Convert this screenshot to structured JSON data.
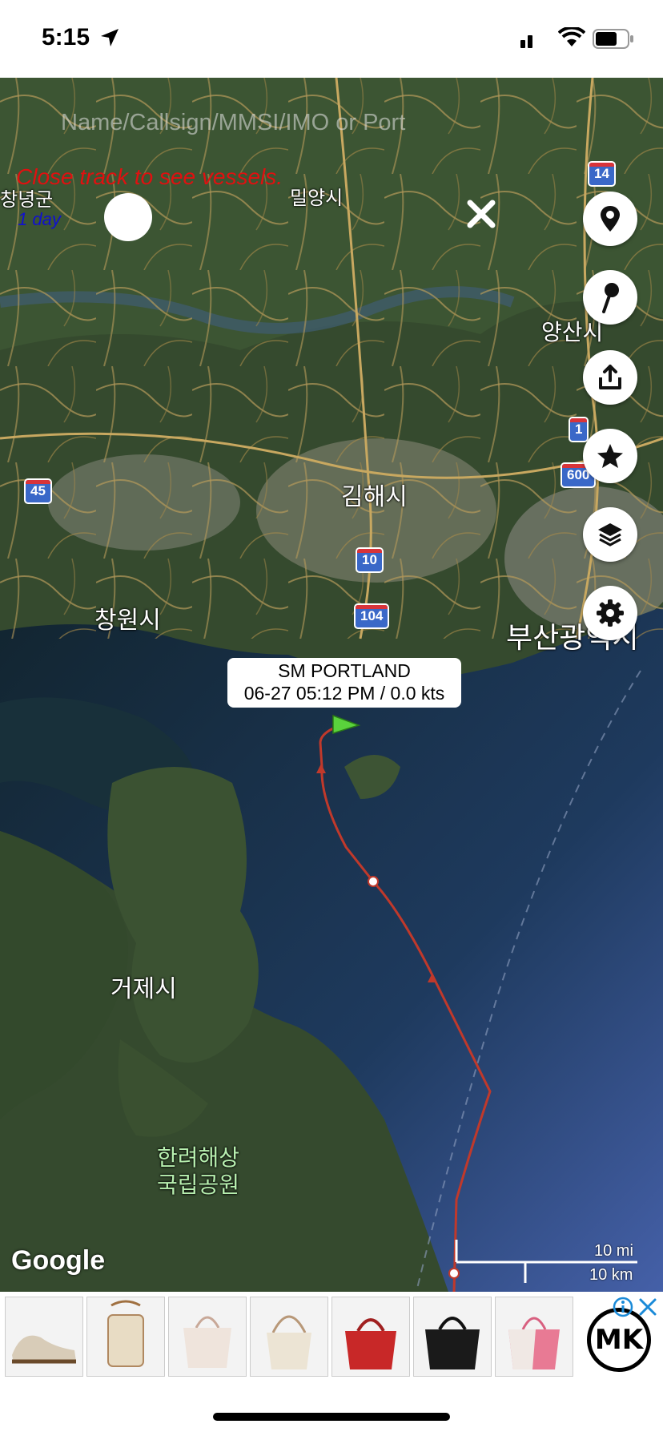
{
  "status_bar": {
    "time": "5:15"
  },
  "search": {
    "placeholder": "Name/Callsign/MMSI/IMO or Port"
  },
  "track": {
    "message": "Close track to see vessels.",
    "period": "1 day"
  },
  "vessel": {
    "name": "SM PORTLAND",
    "status": "06-27 05:12 PM / 0.0 kts"
  },
  "places": [
    {
      "label": "밀양시"
    },
    {
      "label": "양산시"
    },
    {
      "label": "김해시"
    },
    {
      "label": "창원시"
    },
    {
      "label": "부산광역시"
    },
    {
      "label": "거제시"
    },
    {
      "label": "한려해상"
    },
    {
      "label": "국립공원"
    },
    {
      "label": "창녕군"
    }
  ],
  "road_shields": [
    "14",
    "1",
    "600",
    "45",
    "10",
    "104"
  ],
  "map_brand": "Google",
  "scale": {
    "miles": "10 mi",
    "km": "10 km"
  },
  "toolbar": {
    "buttons": [
      "location-button",
      "pin-button",
      "share-button",
      "favorites-button",
      "layers-button",
      "settings-button"
    ]
  },
  "ad": {
    "brand": "MK",
    "item_count": 7
  },
  "colors": {
    "track": "#c0392b",
    "flag": "#5ad23c",
    "shield": "#3a68c8",
    "alert_text": "#e01010",
    "period_text": "#1010d0"
  }
}
